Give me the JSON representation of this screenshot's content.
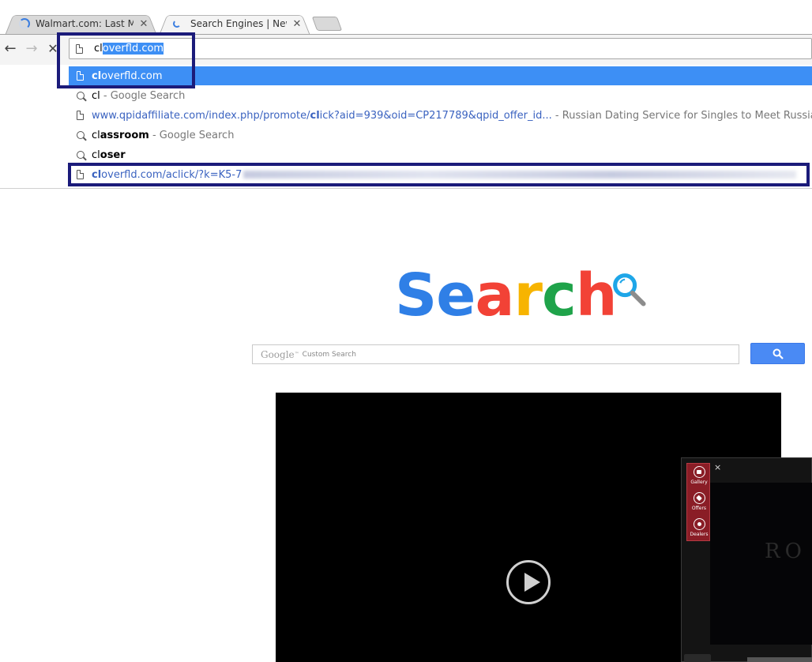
{
  "tabs": [
    {
      "title": "Walmart.com: Last Minute",
      "close": "✕",
      "loading": true
    },
    {
      "title": "Search Engines | News se",
      "close": "✕",
      "loading": true
    }
  ],
  "omnibox": {
    "typed": "cl",
    "completion": "overfld.com"
  },
  "dropdown": {
    "r0": {
      "bold": "cl",
      "rest": "overfld.com"
    },
    "r1": {
      "query": "cl",
      "suffix": " - Google Search"
    },
    "r2": {
      "url_pre": "www.qpidaffiliate.com/index.php/promote/",
      "url_bold": "cl",
      "url_post": "ick?aid=939&oid=CP217789&qpid_offer_id...",
      "desc": " - Russian Dating Service for Singles to Meet Russian Wo"
    },
    "r3": {
      "bold1": "cl",
      "bold2": "assroom",
      "suffix": " - Google Search"
    },
    "r4": {
      "pre": "cl",
      "bold": "oser"
    },
    "r5": {
      "bold": "cl",
      "rest": "overfld.com/aclick/?k=K5-7"
    }
  },
  "logo": {
    "letters": [
      "S",
      "e",
      "a",
      "r",
      "c",
      "h"
    ],
    "colors": [
      "#2f7fe6",
      "#2f7fe6",
      "#f24236",
      "#f7b400",
      "#1fa34a",
      "#f24236"
    ]
  },
  "search": {
    "brand": "Google",
    "tm": "™",
    "custom": "Custom Search"
  },
  "popup": {
    "close": "×",
    "menu": [
      "Gallery",
      "Offers",
      "Dealers"
    ],
    "ghost": "RO"
  }
}
